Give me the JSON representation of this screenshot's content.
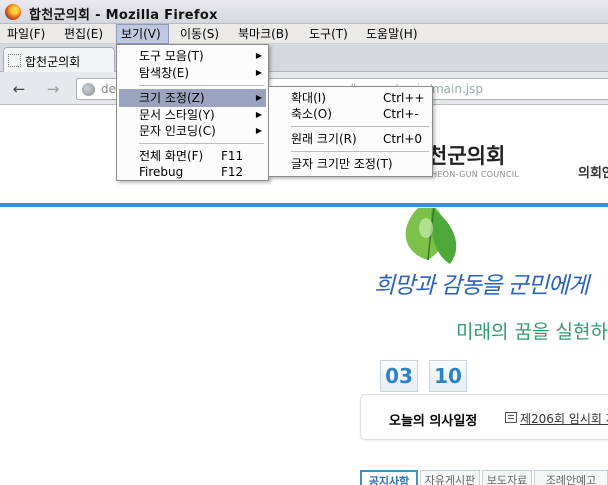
{
  "window": {
    "title": "합천군의회 - Mozilla Firefox",
    "icon": "firefox-icon"
  },
  "menubar": [
    {
      "label": "파일(F)",
      "active": false
    },
    {
      "label": "편집(E)",
      "active": false
    },
    {
      "label": "보기(V)",
      "active": true
    },
    {
      "label": "이동(S)",
      "active": false
    },
    {
      "label": "북마크(B)",
      "active": false
    },
    {
      "label": "도구(T)",
      "active": false
    },
    {
      "label": "도움말(H)",
      "active": false
    }
  ],
  "tab": {
    "label": "합천군의회"
  },
  "navbar": {
    "back": "←",
    "forward": "→",
    "url_prefix": "de",
    "url_suffix": "/korean/main/main.jsp"
  },
  "view_menu": {
    "items": [
      {
        "label": "도구 모음(T)",
        "submenu": true
      },
      {
        "label": "탐색창(E)",
        "submenu": true
      },
      {
        "label": "크기 조정(Z)",
        "submenu": true,
        "highlighted": true
      },
      {
        "label": "문서 스타일(Y)",
        "submenu": true
      },
      {
        "label": "문자 인코딩(C)",
        "submenu": true
      },
      {
        "label": "전체 화면(F)",
        "shortcut": "F11"
      },
      {
        "label": "Firebug",
        "shortcut": "F12"
      }
    ]
  },
  "zoom_submenu": {
    "items": [
      {
        "label": "확대(I)",
        "shortcut": "Ctrl++"
      },
      {
        "label": "축소(O)",
        "shortcut": "Ctrl+-"
      },
      {
        "label": "원래 크기(R)",
        "shortcut": "Ctrl+0"
      },
      {
        "label": "글자 크기만 조정(T)"
      }
    ]
  },
  "page": {
    "logo": "천군의회",
    "logo_sub": "HAPCHEON-GUN COUNCIL",
    "nav_item": "의회안",
    "slogan1": "희망과 감동을 군민에게",
    "slogan2": "미래의 꿈을 실현하",
    "date": [
      "03",
      "10"
    ],
    "schedule_title": "오늘의 의사일정",
    "schedule_link": "제206회 임시회 제",
    "tabs": [
      "공지사항",
      "자유게시판",
      "보도자료",
      "조례안예고"
    ],
    "colors": {
      "accent_blue": "#3d8fd1",
      "slogan_blue": "#2a62b8",
      "slogan_green": "#2f9b6a"
    }
  }
}
